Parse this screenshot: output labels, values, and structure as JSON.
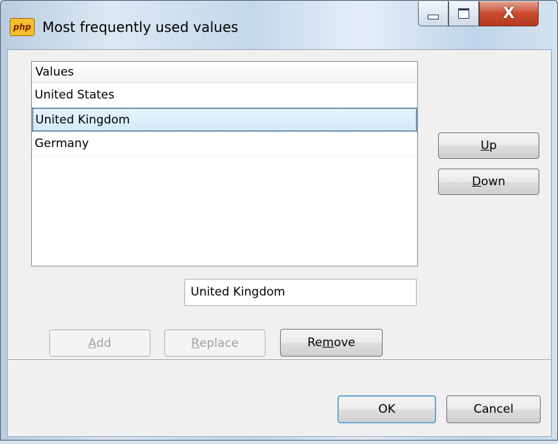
{
  "window": {
    "title": "Most frequently used values",
    "app_icon_text": "php",
    "controls": {
      "minimize": "—",
      "maximize": "□",
      "close": "X"
    }
  },
  "list": {
    "header": "Values",
    "items": [
      "United States",
      "United Kingdom",
      "Germany"
    ],
    "selected_index": 1
  },
  "buttons": {
    "up": {
      "accel": "U",
      "rest": "p"
    },
    "down": {
      "accel": "D",
      "rest": "own"
    },
    "add": {
      "accel": "A",
      "rest": "dd"
    },
    "replace": {
      "accel": "R",
      "rest": "eplace"
    },
    "remove": {
      "pre": "Re",
      "accel": "m",
      "rest": "ove"
    },
    "ok": "OK",
    "cancel": "Cancel"
  },
  "value_input": {
    "value": "United Kingdom"
  },
  "colors": {
    "selection": "#d3eaf9",
    "close_button": "#c84b2f",
    "app_icon": "#f5c030"
  }
}
